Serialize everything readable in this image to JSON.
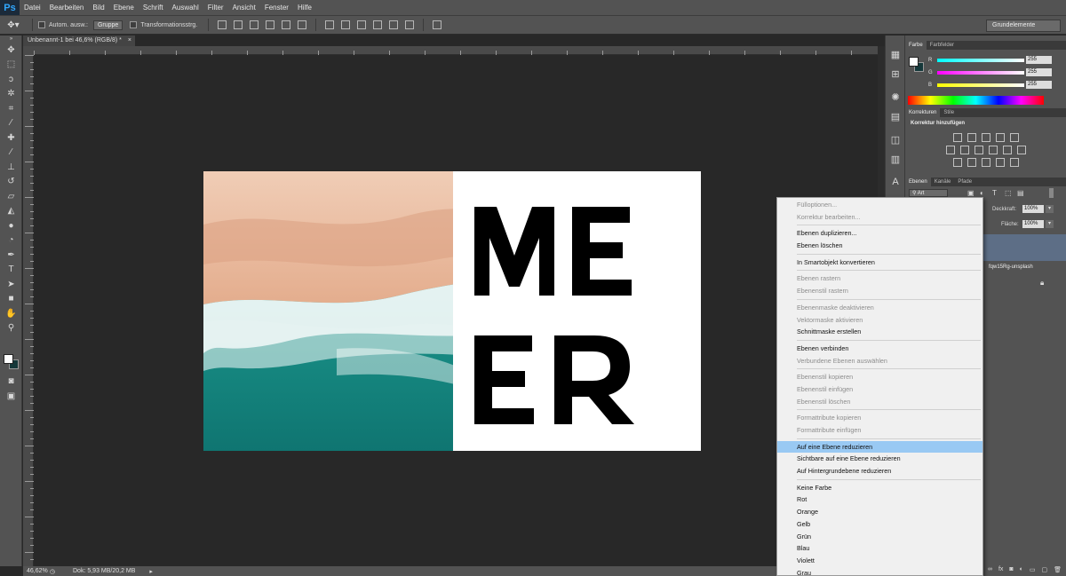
{
  "menubar": {
    "logo": "Ps",
    "items": [
      "Datei",
      "Bearbeiten",
      "Bild",
      "Ebene",
      "Schrift",
      "Auswahl",
      "Filter",
      "Ansicht",
      "Fenster",
      "Hilfe"
    ]
  },
  "options": {
    "auto_select_label": "Autom. ausw.:",
    "auto_select_value": "Gruppe",
    "transform_label": "Transformationsstrg.",
    "workspace": "Grundelemente"
  },
  "document": {
    "tab_title": "Unbenannt-1 bei 46,6% (RGB/8) *",
    "zoom": "46,62%",
    "doc_info": "Dok: 5,93 MB/20,2 MB",
    "headline_line1": "ME",
    "headline_line2": "ER"
  },
  "color_panel": {
    "tabs": [
      "Farbe",
      "Farbfelder"
    ],
    "r_label": "R",
    "r_value": "255",
    "g_label": "G",
    "g_value": "255",
    "b_label": "B",
    "b_value": "255"
  },
  "korrekturen": {
    "tabs": [
      "Korrekturen",
      "Stile"
    ],
    "title": "Korrektur hinzufügen"
  },
  "layers": {
    "tabs": [
      "Ebenen",
      "Kanäle",
      "Pfade"
    ],
    "filter_label": "Art",
    "opacity_label": "Deckkraft:",
    "opacity_value": "100%",
    "fill_label": "Fläche:",
    "fill_value": "100%",
    "layer_name": "fqw15Rg-unsplash"
  },
  "context_menu": {
    "groups": [
      [
        {
          "label": "Fülloptionen...",
          "disabled": true
        },
        {
          "label": "Korrektur bearbeiten...",
          "disabled": true
        }
      ],
      [
        {
          "label": "Ebenen duplizieren...",
          "disabled": false
        },
        {
          "label": "Ebenen löschen",
          "disabled": false
        }
      ],
      [
        {
          "label": "In Smartobjekt konvertieren",
          "disabled": false
        }
      ],
      [
        {
          "label": "Ebenen rastern",
          "disabled": true
        },
        {
          "label": "Ebenenstil rastern",
          "disabled": true
        }
      ],
      [
        {
          "label": "Ebenenmaske deaktivieren",
          "disabled": true
        },
        {
          "label": "Vektormaske aktivieren",
          "disabled": true
        },
        {
          "label": "Schnittmaske erstellen",
          "disabled": false
        }
      ],
      [
        {
          "label": "Ebenen verbinden",
          "disabled": false
        },
        {
          "label": "Verbundene Ebenen auswählen",
          "disabled": true
        }
      ],
      [
        {
          "label": "Ebenenstil kopieren",
          "disabled": true
        },
        {
          "label": "Ebenenstil einfügen",
          "disabled": true
        },
        {
          "label": "Ebenenstil löschen",
          "disabled": true
        }
      ],
      [
        {
          "label": "Formattribute kopieren",
          "disabled": true
        },
        {
          "label": "Formattribute einfügen",
          "disabled": true
        }
      ],
      [
        {
          "label": "Auf eine Ebene reduzieren",
          "disabled": false,
          "selected": true
        },
        {
          "label": "Sichtbare auf eine Ebene reduzieren",
          "disabled": false
        },
        {
          "label": "Auf Hintergrundebene reduzieren",
          "disabled": false
        }
      ],
      [
        {
          "label": "Keine Farbe",
          "disabled": false
        },
        {
          "label": "Rot",
          "disabled": false
        },
        {
          "label": "Orange",
          "disabled": false
        },
        {
          "label": "Gelb",
          "disabled": false
        },
        {
          "label": "Grün",
          "disabled": false
        },
        {
          "label": "Blau",
          "disabled": false
        },
        {
          "label": "Violett",
          "disabled": false
        },
        {
          "label": "Grau",
          "disabled": false
        }
      ]
    ]
  }
}
